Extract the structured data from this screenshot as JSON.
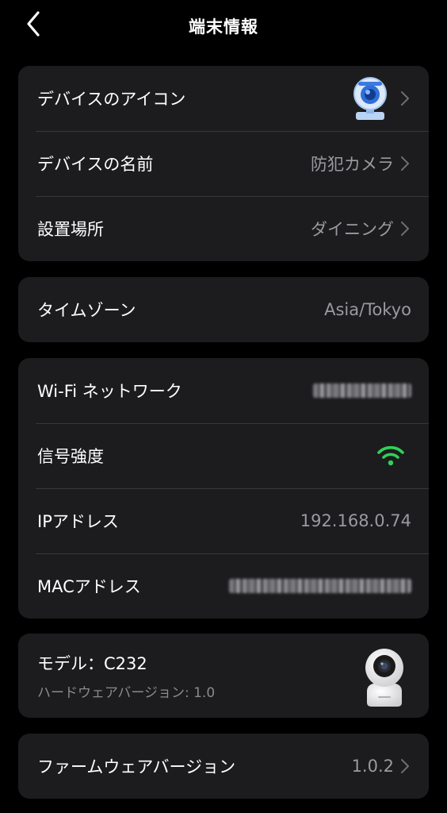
{
  "header": {
    "title": "端末情報"
  },
  "device_section": {
    "icon_row_label": "デバイスのアイコン",
    "name_row": {
      "label": "デバイスの名前",
      "value": "防犯カメラ"
    },
    "location_row": {
      "label": "設置場所",
      "value": "ダイニング"
    }
  },
  "timezone_section": {
    "label": "タイムゾーン",
    "value": "Asia/Tokyo"
  },
  "network_section": {
    "wifi": {
      "label": "Wi-Fi ネットワーク",
      "value_state": "blurred"
    },
    "signal": {
      "label": "信号強度",
      "icon": "wifi-signal-icon",
      "color": "#30d158"
    },
    "ip": {
      "label": "IPアドレス",
      "value": "192.168.0.74"
    },
    "mac": {
      "label": "MACアドレス",
      "value_state": "blurred"
    }
  },
  "model_section": {
    "title": "モデル：C232",
    "hardware_version": "ハードウェアバージョン: 1.0"
  },
  "firmware_section": {
    "label": "ファームウェアバージョン",
    "value": "1.0.2"
  },
  "colors": {
    "background": "#000000",
    "card": "#1c1c1e",
    "secondary_text": "#9a9a9f",
    "accent_green": "#30d158"
  }
}
